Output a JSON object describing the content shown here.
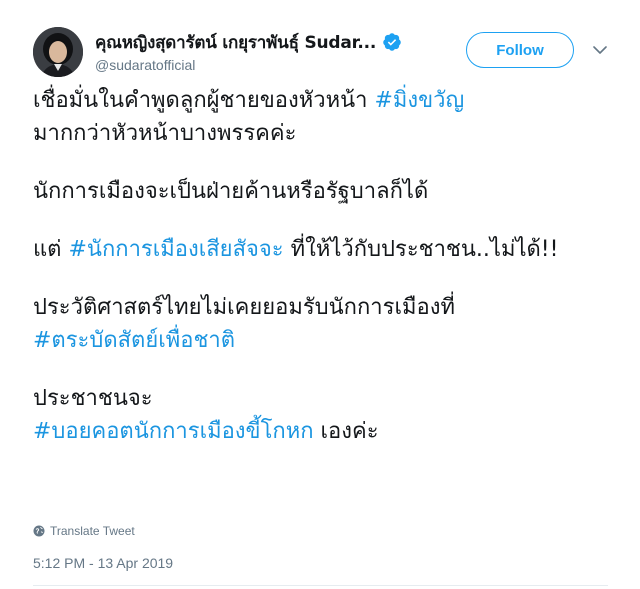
{
  "header": {
    "display_name": "คุณหญิงสุดารัตน์ เกยุราพันธุ์ Sudar...",
    "handle": "@sudaratofficial",
    "follow_label": "Follow"
  },
  "tweet": {
    "line1_text": "เชื่อมั่นในคำพูดลูกผู้ชายของหัวหน้า ",
    "line1_hashtag": "#มิ่งขวัญ",
    "line1_cont": " มากกว่าหัวหน้าบางพรรคค่ะ",
    "para2": "นักการเมืองจะเป็นฝ่ายค้านหรือรัฐบาลก็ได้",
    "para3_pre": "แต่ ",
    "para3_hashtag": "#นักการเมืองเสียสัจจะ",
    "para3_post": " ที่ให้ไว้กับประชาชน..ไม่ได้!!",
    "para4_text": "ประวัติศาสตร์ไทยไม่เคยยอมรับนักการเมืองที่ ",
    "para4_hashtag": "#ตระบัดสัตย์เพื่อชาติ",
    "para5_pre": "ประชาชนจะ ",
    "para5_hashtag": "#บอยคอตนักการเมืองขี้โกหก",
    "para5_post": " เองค่ะ"
  },
  "translate_label": "Translate Tweet",
  "timestamp": "5:12 PM - 13 Apr 2019",
  "colors": {
    "link": "#1b95e0",
    "follow": "#1da1f2",
    "secondary_text": "#657786"
  },
  "icons": {
    "verified": "verified-badge-icon",
    "caret": "chevron-down-icon",
    "translate": "globe-icon"
  }
}
